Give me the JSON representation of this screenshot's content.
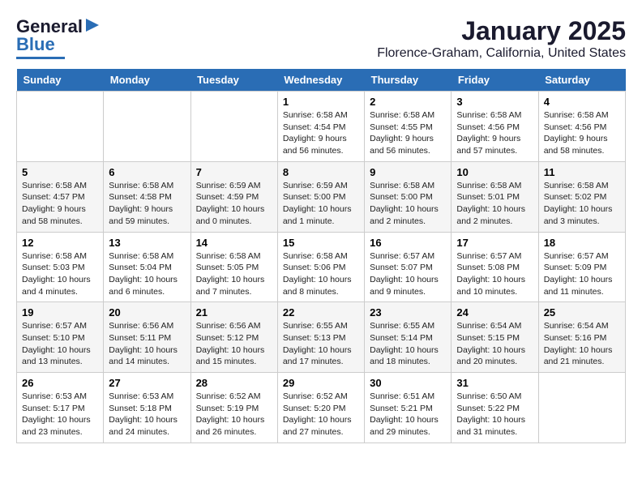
{
  "logo": {
    "line1": "General",
    "line2": "Blue"
  },
  "title": "January 2025",
  "subtitle": "Florence-Graham, California, United States",
  "weekdays": [
    "Sunday",
    "Monday",
    "Tuesday",
    "Wednesday",
    "Thursday",
    "Friday",
    "Saturday"
  ],
  "weeks": [
    [
      {
        "day": "",
        "sunrise": "",
        "sunset": "",
        "daylight": ""
      },
      {
        "day": "",
        "sunrise": "",
        "sunset": "",
        "daylight": ""
      },
      {
        "day": "",
        "sunrise": "",
        "sunset": "",
        "daylight": ""
      },
      {
        "day": "1",
        "sunrise": "Sunrise: 6:58 AM",
        "sunset": "Sunset: 4:54 PM",
        "daylight": "Daylight: 9 hours and 56 minutes."
      },
      {
        "day": "2",
        "sunrise": "Sunrise: 6:58 AM",
        "sunset": "Sunset: 4:55 PM",
        "daylight": "Daylight: 9 hours and 56 minutes."
      },
      {
        "day": "3",
        "sunrise": "Sunrise: 6:58 AM",
        "sunset": "Sunset: 4:56 PM",
        "daylight": "Daylight: 9 hours and 57 minutes."
      },
      {
        "day": "4",
        "sunrise": "Sunrise: 6:58 AM",
        "sunset": "Sunset: 4:56 PM",
        "daylight": "Daylight: 9 hours and 58 minutes."
      }
    ],
    [
      {
        "day": "5",
        "sunrise": "Sunrise: 6:58 AM",
        "sunset": "Sunset: 4:57 PM",
        "daylight": "Daylight: 9 hours and 58 minutes."
      },
      {
        "day": "6",
        "sunrise": "Sunrise: 6:58 AM",
        "sunset": "Sunset: 4:58 PM",
        "daylight": "Daylight: 9 hours and 59 minutes."
      },
      {
        "day": "7",
        "sunrise": "Sunrise: 6:59 AM",
        "sunset": "Sunset: 4:59 PM",
        "daylight": "Daylight: 10 hours and 0 minutes."
      },
      {
        "day": "8",
        "sunrise": "Sunrise: 6:59 AM",
        "sunset": "Sunset: 5:00 PM",
        "daylight": "Daylight: 10 hours and 1 minute."
      },
      {
        "day": "9",
        "sunrise": "Sunrise: 6:58 AM",
        "sunset": "Sunset: 5:00 PM",
        "daylight": "Daylight: 10 hours and 2 minutes."
      },
      {
        "day": "10",
        "sunrise": "Sunrise: 6:58 AM",
        "sunset": "Sunset: 5:01 PM",
        "daylight": "Daylight: 10 hours and 2 minutes."
      },
      {
        "day": "11",
        "sunrise": "Sunrise: 6:58 AM",
        "sunset": "Sunset: 5:02 PM",
        "daylight": "Daylight: 10 hours and 3 minutes."
      }
    ],
    [
      {
        "day": "12",
        "sunrise": "Sunrise: 6:58 AM",
        "sunset": "Sunset: 5:03 PM",
        "daylight": "Daylight: 10 hours and 4 minutes."
      },
      {
        "day": "13",
        "sunrise": "Sunrise: 6:58 AM",
        "sunset": "Sunset: 5:04 PM",
        "daylight": "Daylight: 10 hours and 6 minutes."
      },
      {
        "day": "14",
        "sunrise": "Sunrise: 6:58 AM",
        "sunset": "Sunset: 5:05 PM",
        "daylight": "Daylight: 10 hours and 7 minutes."
      },
      {
        "day": "15",
        "sunrise": "Sunrise: 6:58 AM",
        "sunset": "Sunset: 5:06 PM",
        "daylight": "Daylight: 10 hours and 8 minutes."
      },
      {
        "day": "16",
        "sunrise": "Sunrise: 6:57 AM",
        "sunset": "Sunset: 5:07 PM",
        "daylight": "Daylight: 10 hours and 9 minutes."
      },
      {
        "day": "17",
        "sunrise": "Sunrise: 6:57 AM",
        "sunset": "Sunset: 5:08 PM",
        "daylight": "Daylight: 10 hours and 10 minutes."
      },
      {
        "day": "18",
        "sunrise": "Sunrise: 6:57 AM",
        "sunset": "Sunset: 5:09 PM",
        "daylight": "Daylight: 10 hours and 11 minutes."
      }
    ],
    [
      {
        "day": "19",
        "sunrise": "Sunrise: 6:57 AM",
        "sunset": "Sunset: 5:10 PM",
        "daylight": "Daylight: 10 hours and 13 minutes."
      },
      {
        "day": "20",
        "sunrise": "Sunrise: 6:56 AM",
        "sunset": "Sunset: 5:11 PM",
        "daylight": "Daylight: 10 hours and 14 minutes."
      },
      {
        "day": "21",
        "sunrise": "Sunrise: 6:56 AM",
        "sunset": "Sunset: 5:12 PM",
        "daylight": "Daylight: 10 hours and 15 minutes."
      },
      {
        "day": "22",
        "sunrise": "Sunrise: 6:55 AM",
        "sunset": "Sunset: 5:13 PM",
        "daylight": "Daylight: 10 hours and 17 minutes."
      },
      {
        "day": "23",
        "sunrise": "Sunrise: 6:55 AM",
        "sunset": "Sunset: 5:14 PM",
        "daylight": "Daylight: 10 hours and 18 minutes."
      },
      {
        "day": "24",
        "sunrise": "Sunrise: 6:54 AM",
        "sunset": "Sunset: 5:15 PM",
        "daylight": "Daylight: 10 hours and 20 minutes."
      },
      {
        "day": "25",
        "sunrise": "Sunrise: 6:54 AM",
        "sunset": "Sunset: 5:16 PM",
        "daylight": "Daylight: 10 hours and 21 minutes."
      }
    ],
    [
      {
        "day": "26",
        "sunrise": "Sunrise: 6:53 AM",
        "sunset": "Sunset: 5:17 PM",
        "daylight": "Daylight: 10 hours and 23 minutes."
      },
      {
        "day": "27",
        "sunrise": "Sunrise: 6:53 AM",
        "sunset": "Sunset: 5:18 PM",
        "daylight": "Daylight: 10 hours and 24 minutes."
      },
      {
        "day": "28",
        "sunrise": "Sunrise: 6:52 AM",
        "sunset": "Sunset: 5:19 PM",
        "daylight": "Daylight: 10 hours and 26 minutes."
      },
      {
        "day": "29",
        "sunrise": "Sunrise: 6:52 AM",
        "sunset": "Sunset: 5:20 PM",
        "daylight": "Daylight: 10 hours and 27 minutes."
      },
      {
        "day": "30",
        "sunrise": "Sunrise: 6:51 AM",
        "sunset": "Sunset: 5:21 PM",
        "daylight": "Daylight: 10 hours and 29 minutes."
      },
      {
        "day": "31",
        "sunrise": "Sunrise: 6:50 AM",
        "sunset": "Sunset: 5:22 PM",
        "daylight": "Daylight: 10 hours and 31 minutes."
      },
      {
        "day": "",
        "sunrise": "",
        "sunset": "",
        "daylight": ""
      }
    ]
  ]
}
